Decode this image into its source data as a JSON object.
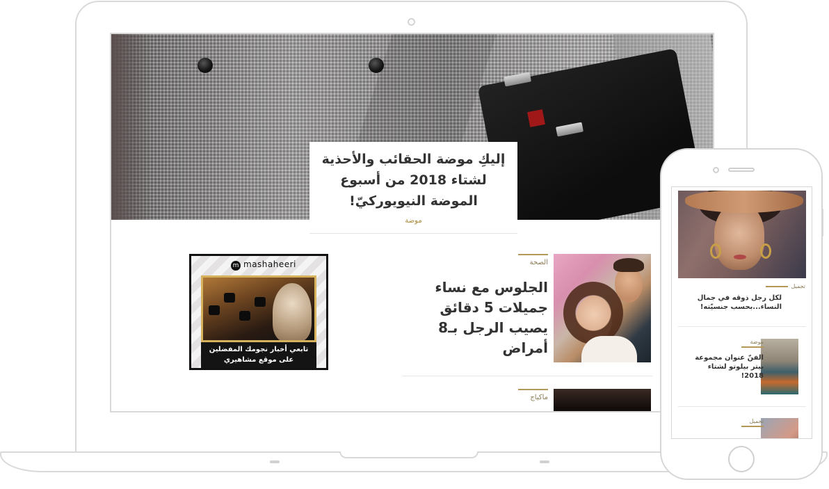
{
  "laptop": {
    "hero": {
      "title": "إليكِ موضة الحقائب والأحذية لشتاء 2018 من أسبوع الموضة النيويوركيّ!",
      "category": "موضة"
    },
    "articles": [
      {
        "category": "الصحة",
        "title": "الجلوس مع نساء جميلات 5 دقائق يصيب الرجل بـ8 أمراض"
      },
      {
        "category": "ماكياج",
        "title": ""
      }
    ],
    "ad": {
      "brand": "mashaheeri",
      "brand_badge": "m",
      "line1": "تابعي أخبار نجومك المفضلين",
      "line2": "على موقع مشاهيري"
    }
  },
  "phone": {
    "hero_item": {
      "category": "تجميل",
      "title": "لكل رجل ذوقه في جمال النساء...بحسب جنسيّته!"
    },
    "items": [
      {
        "category": "موضة",
        "title": "الفنّ عنوان مجموعة بيتر بيلوتو لشتاء 2018!"
      },
      {
        "category": "تجميل",
        "title": ""
      }
    ]
  },
  "colors": {
    "accent_gold": "#b3985a",
    "tag_text": "#8a7a56",
    "heading_text": "#333333",
    "device_frame": "#d9d9d9"
  }
}
